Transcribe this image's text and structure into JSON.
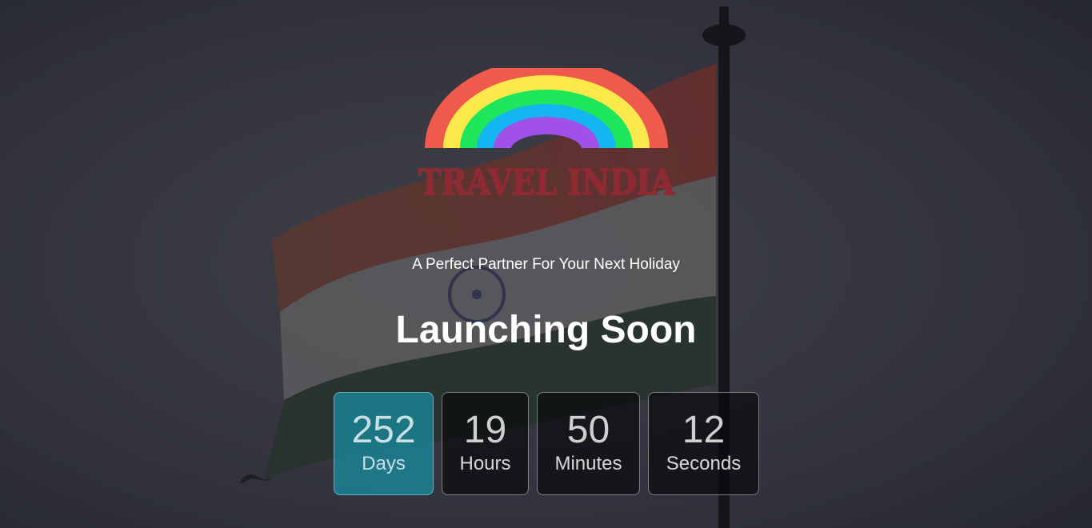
{
  "brand": {
    "name": "TRAVEL INDIA",
    "logo_icon": "rainbow-icon",
    "name_color": "#8e2a32"
  },
  "tagline": "A Perfect Partner For Your Next Holiday",
  "headline": "Launching Soon",
  "countdown": [
    {
      "value": "252",
      "unit": "Days",
      "active": true
    },
    {
      "value": "19",
      "unit": "Hours",
      "active": false
    },
    {
      "value": "50",
      "unit": "Minutes",
      "active": false
    },
    {
      "value": "12",
      "unit": "Seconds",
      "active": false
    }
  ],
  "colors": {
    "accent": "#1f8fa0",
    "rainbow": [
      "#f05a4d",
      "#fbe84a",
      "#1ee65a",
      "#13b6f0",
      "#a051e8"
    ]
  }
}
